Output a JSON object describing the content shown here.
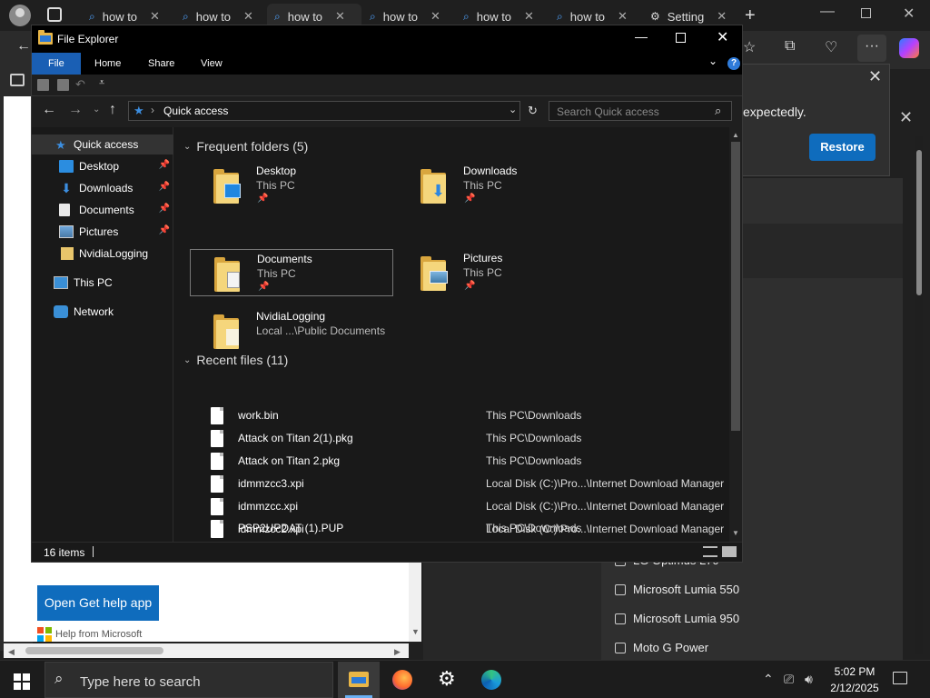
{
  "browser": {
    "tabs": [
      {
        "label": "how to"
      },
      {
        "label": "how to"
      },
      {
        "label": "how to"
      },
      {
        "label": "how to"
      },
      {
        "label": "how to"
      },
      {
        "label": "how to"
      },
      {
        "label": "Setting"
      }
    ],
    "restore_message": "expectedly.",
    "restore_button": "Restore",
    "help_button": "Open Get help app",
    "help_from": "Help from Microsoft",
    "devices": [
      {
        "label": "LG Optimus L70"
      },
      {
        "label": "Microsoft Lumia 550"
      },
      {
        "label": "Microsoft Lumia 950"
      },
      {
        "label": "Moto G Power"
      }
    ],
    "ms_colors": [
      "#f25022",
      "#7fba00",
      "#00a4ef",
      "#ffb900"
    ]
  },
  "explorer": {
    "title": "File Explorer",
    "ribbon_tabs": {
      "file": "File",
      "home": "Home",
      "share": "Share",
      "view": "View"
    },
    "address": "Quick access",
    "search_placeholder": "Search Quick access",
    "nav": {
      "quick_access": "Quick access",
      "desktop": "Desktop",
      "downloads": "Downloads",
      "documents": "Documents",
      "pictures": "Pictures",
      "nvidia": "NvidiaLogging",
      "this_pc": "This PC",
      "network": "Network"
    },
    "frequent_header": "Frequent folders (5)",
    "frequent": [
      {
        "name": "Desktop",
        "location": "This PC"
      },
      {
        "name": "Downloads",
        "location": "This PC"
      },
      {
        "name": "Documents",
        "location": "This PC"
      },
      {
        "name": "Pictures",
        "location": "This PC"
      },
      {
        "name": "NvidiaLogging",
        "location": "Local ...\\Public Documents"
      }
    ],
    "recent_header": "Recent files (11)",
    "recent": [
      {
        "name": "work.bin",
        "path": "This PC\\Downloads"
      },
      {
        "name": "Attack on Titan 2(1).pkg",
        "path": "This PC\\Downloads"
      },
      {
        "name": "Attack on Titan 2.pkg",
        "path": "This PC\\Downloads"
      },
      {
        "name": "idmmzcc3.xpi",
        "path": "Local Disk (C:)\\Pro...\\Internet Download Manager"
      },
      {
        "name": "idmmzcc.xpi",
        "path": "Local Disk (C:)\\Pro...\\Internet Download Manager"
      },
      {
        "name": "idmmzcc2.xpi",
        "path": "Local Disk (C:)\\Pro...\\Internet Download Manager"
      },
      {
        "name": "PSP2UPDAT (1).PUP",
        "path": "This PC\\Downloads"
      }
    ],
    "status": "16 items"
  },
  "taskbar": {
    "search_placeholder": "Type here to search",
    "time": "5:02 PM",
    "date": "2/12/2025"
  }
}
